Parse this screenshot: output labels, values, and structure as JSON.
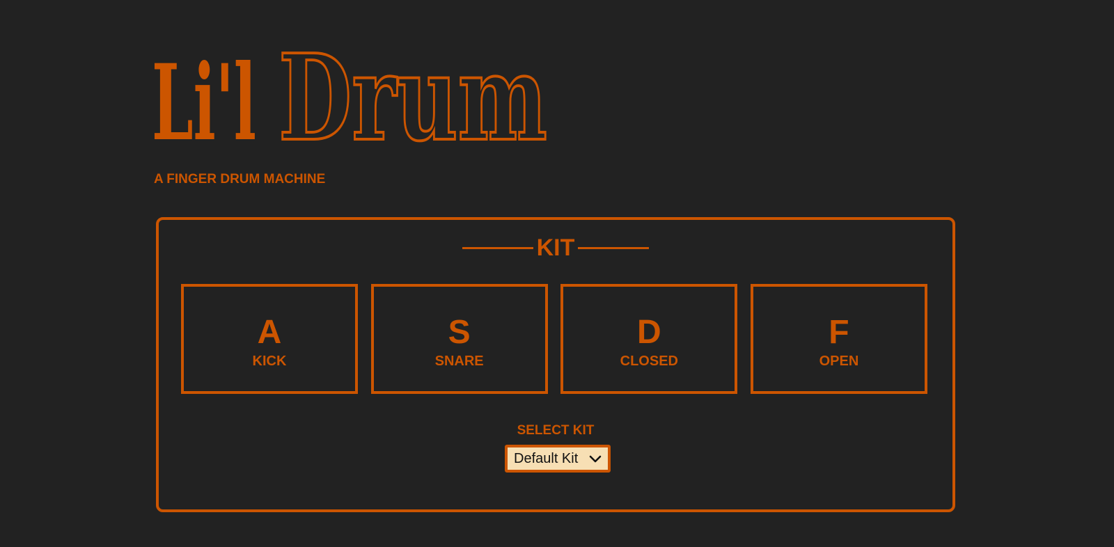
{
  "app": {
    "logo_part1": "Li'l",
    "logo_part2": "Drum",
    "tagline": "A FINGER DRUM MACHINE"
  },
  "kit": {
    "title": "KIT",
    "pads": [
      {
        "key": "A",
        "sound": "KICK"
      },
      {
        "key": "S",
        "sound": "SNARE"
      },
      {
        "key": "D",
        "sound": "CLOSED"
      },
      {
        "key": "F",
        "sound": "OPEN"
      }
    ],
    "select_label": "SELECT KIT",
    "selected_kit": "Default Kit"
  },
  "icons": {
    "select": "chevron-down-icon"
  },
  "colors": {
    "background": "#222222",
    "accent": "#cc5500",
    "select_background": "#f7dfb4"
  }
}
